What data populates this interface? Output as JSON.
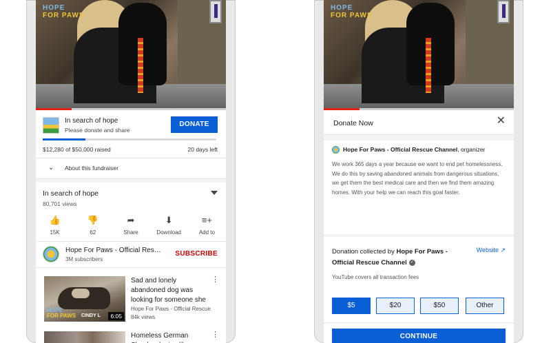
{
  "video": {
    "overlay_logo_line1": "HOPE",
    "overlay_logo_line2": "FOR PAWS",
    "progress_fraction": 0.19
  },
  "fundraiser": {
    "title": "In search of hope",
    "subtitle": "Please donate and share",
    "donate_label": "DONATE",
    "raised_text": "$12,280 of $50,000 raised",
    "raised_fraction": 0.246,
    "days_left": "20 days left",
    "about_label": "About this fundraiser"
  },
  "video_info": {
    "title": "In search of hope",
    "views": "80,701 views",
    "actions": [
      {
        "icon": "thumbs-up-icon",
        "glyph": "👍",
        "label": "15K"
      },
      {
        "icon": "thumbs-down-icon",
        "glyph": "👎",
        "label": "62"
      },
      {
        "icon": "share-icon",
        "glyph": "➦",
        "label": "Share"
      },
      {
        "icon": "download-icon",
        "glyph": "⬇",
        "label": "Download"
      },
      {
        "icon": "add-to-icon",
        "glyph": "≡+",
        "label": "Add to"
      }
    ]
  },
  "channel": {
    "name": "Hope For Paws - Official Res…",
    "subscribers": "3M subscribers",
    "subscribe_label": "SUBSCRIBE"
  },
  "recommendations": [
    {
      "title": "Sad and lonely abandoned dog was looking for someone she",
      "channel": "Hope For Paws - Official Rescue",
      "views": "84k views",
      "duration": "6:05",
      "thumb_logo_line1": "HOPE",
      "thumb_logo_line2": "FOR PAWS",
      "thumb_caption": "CINDY L"
    },
    {
      "title": "Homeless German Shepherd cries like a"
    }
  ],
  "donate_panel": {
    "title": "Donate Now",
    "close_glyph": "✕",
    "org_name": "Hope For Paws - Official Rescue Channel",
    "org_role": ", organizer",
    "description": "We work 365 days a year because we want to end pet homelessness. We do this by saving abandoned animals from dangerous situations, we get them the best medical care and then we find them amazing homes. With your help we can reach this goal faster.",
    "collected_prefix": "Donation collected by ",
    "collected_org": "Hope For Paws - Official Rescue Channel",
    "website_label": "Website ↗",
    "fees_text": "YouTube covers all transaction fees",
    "amounts": [
      "$5",
      "$20",
      "$50",
      "Other"
    ],
    "selected_amount": "$5",
    "continue_label": "CONTINUE"
  },
  "colors": {
    "accent_blue": "#0b5fd6",
    "subscribe_red": "#cc0000",
    "video_progress_red": "#e62117"
  }
}
